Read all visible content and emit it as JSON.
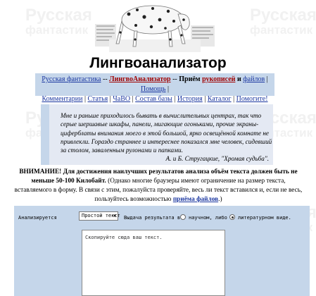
{
  "watermarks": [
    {
      "line1": "Русская",
      "line2": "фантастик"
    },
    {
      "line1": "Русская",
      "line2": "фантастик"
    },
    {
      "line1": "Русская",
      "line2": "фантастик"
    },
    {
      "line1": "Русская",
      "line2": "фантастик"
    },
    {
      "line1": "Русская",
      "line2": "фантастик"
    }
  ],
  "header": {
    "image_icon": "dalmatian-dog-illustration",
    "title": "Лингвоанализатор"
  },
  "nav": {
    "row1": [
      {
        "label": "Русская фантастика",
        "link": true
      },
      {
        "label": " -- ",
        "link": false
      },
      {
        "label": "ЛингвоАнализатор",
        "link": true,
        "active": true
      },
      {
        "label": " -- ",
        "link": false
      },
      {
        "label": "Приём ",
        "link": false,
        "bold": true
      },
      {
        "label": "рукописей",
        "link": true,
        "active": true
      },
      {
        "label": " и ",
        "link": false,
        "bold": true
      },
      {
        "label": "файлов",
        "link": true
      },
      {
        "label": " | ",
        "link": false
      },
      {
        "label": "Помощь",
        "link": true
      },
      {
        "label": " |",
        "link": false
      }
    ],
    "row2": [
      {
        "label": "Комментарии",
        "link": true
      },
      {
        "label": " | ",
        "link": false
      },
      {
        "label": "Статья",
        "link": true
      },
      {
        "label": " | ",
        "link": false
      },
      {
        "label": "ЧаВО",
        "link": true
      },
      {
        "label": " | ",
        "link": false
      },
      {
        "label": "Состав базы",
        "link": true
      },
      {
        "label": " | ",
        "link": false
      },
      {
        "label": "История",
        "link": true
      },
      {
        "label": " | ",
        "link": false
      },
      {
        "label": "Каталог",
        "link": true
      },
      {
        "label": " | ",
        "link": false
      },
      {
        "label": "Помогите!",
        "link": true
      }
    ]
  },
  "quote": {
    "text": "Мне и раньше приходилось бывать в вычислительных центрах, так что серые шершавые шкафы, панели, мигающие огоньками, прочие экраны-циферблаты внимания моего в этой большой, ярко освещённой комнате не привлекли. Гораздо страннее и интереснее показался мне человек, сидевший за столом, заваленным рулонами и папками.",
    "signature": "А. и Б. Стругацкие, \"Хромая судьба\"."
  },
  "warning": {
    "part1": "ВНИМАНИЕ! Для достижения наилучших результатов анализа объём текста должен быть не меньше 50-100 Килобайт.",
    "part2": " (Однако многие браузеры имеют ограничение на размер текста, вставляемого в форму. В связи с этим, пожалуйста проверяйте, весь ли текст вставился и, если не весь, пользуйтесь возможностью ",
    "link": "приёма файлов",
    "part3": ".)"
  },
  "form": {
    "analyze_label": "Анализируется",
    "select_value": "Простой текст",
    "output_label": "Выдача результата в",
    "radio1_label": "научном, либо",
    "radio2_label": "литературном виде.",
    "radio_selected": 2,
    "textarea_value": "Скопируйте сюда ваш текст."
  }
}
